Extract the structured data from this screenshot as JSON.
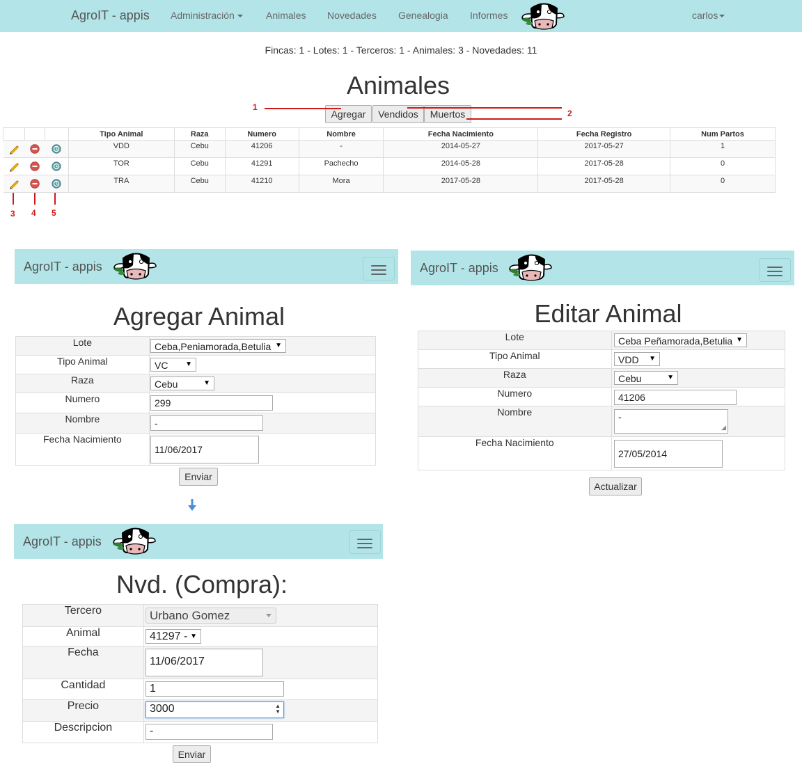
{
  "navbar": {
    "brand": "AgroIT - appis",
    "items": [
      "Administración",
      "Animales",
      "Novedades",
      "Genealogia",
      "Informes"
    ],
    "user": "carlos"
  },
  "summary": "Fincas: 1 - Lotes: 1 - Terceros: 1 - Animales: 3 - Novedades: 11",
  "animales": {
    "title": "Animales",
    "buttons": [
      "Agregar",
      "Vendidos",
      "Muertos"
    ],
    "columns": [
      "Tipo Animal",
      "Raza",
      "Numero",
      "Nombre",
      "Fecha Nacimiento",
      "Fecha Registro",
      "Num Partos"
    ],
    "rows": [
      [
        "VDD",
        "Cebu",
        "41206",
        "-",
        "2014-05-27",
        "2017-05-27",
        "1"
      ],
      [
        "TOR",
        "Cebu",
        "41291",
        "Pachecho",
        "2014-05-28",
        "2017-05-28",
        "0"
      ],
      [
        "TRA",
        "Cebu",
        "41210",
        "Mora",
        "2017-05-28",
        "2017-05-28",
        "0"
      ]
    ],
    "row_icons": [
      "pencil-icon",
      "minus-circle-icon",
      "history-icon"
    ]
  },
  "annotations": {
    "n1": "1",
    "n2": "2",
    "n3": "3",
    "n4": "4",
    "n5": "5",
    "color": "#d01a1a"
  },
  "agregar": {
    "brand": "AgroIT - appis",
    "title": "Agregar Animal",
    "labels": {
      "lote": "Lote",
      "tipo": "Tipo Animal",
      "raza": "Raza",
      "numero": "Numero",
      "nombre": "Nombre",
      "fecha": "Fecha Nacimiento"
    },
    "values": {
      "lote": "Ceba,Peniamorada,Betulia",
      "tipo": "VC",
      "raza": "Cebu",
      "numero": "299",
      "nombre": "-",
      "fecha": "11/06/2017"
    },
    "submit": "Enviar"
  },
  "editar": {
    "brand": "AgroIT - appis",
    "title": "Editar Animal",
    "labels": {
      "lote": "Lote",
      "tipo": "Tipo Animal",
      "raza": "Raza",
      "numero": "Numero",
      "nombre": "Nombre",
      "fecha": "Fecha Nacimiento"
    },
    "values": {
      "lote": "Ceba Peñamorada,Betulia",
      "tipo": "VDD",
      "raza": "Cebu",
      "numero": "41206",
      "nombre": "-",
      "fecha": "27/05/2014"
    },
    "submit": "Actualizar"
  },
  "compra": {
    "brand": "AgroIT - appis",
    "title": "Nvd. (Compra):",
    "labels": {
      "tercero": "Tercero",
      "animal": "Animal",
      "fecha": "Fecha",
      "cantidad": "Cantidad",
      "precio": "Precio",
      "descripcion": "Descripcion"
    },
    "values": {
      "tercero": "Urbano Gomez",
      "animal": "41297 -",
      "fecha": "11/06/2017",
      "cantidad": "1",
      "precio": "3000",
      "descripcion": "-"
    },
    "submit": "Enviar"
  },
  "colors": {
    "navbar": "#b3e5e8",
    "accent_arrow": "#4a90d9"
  }
}
